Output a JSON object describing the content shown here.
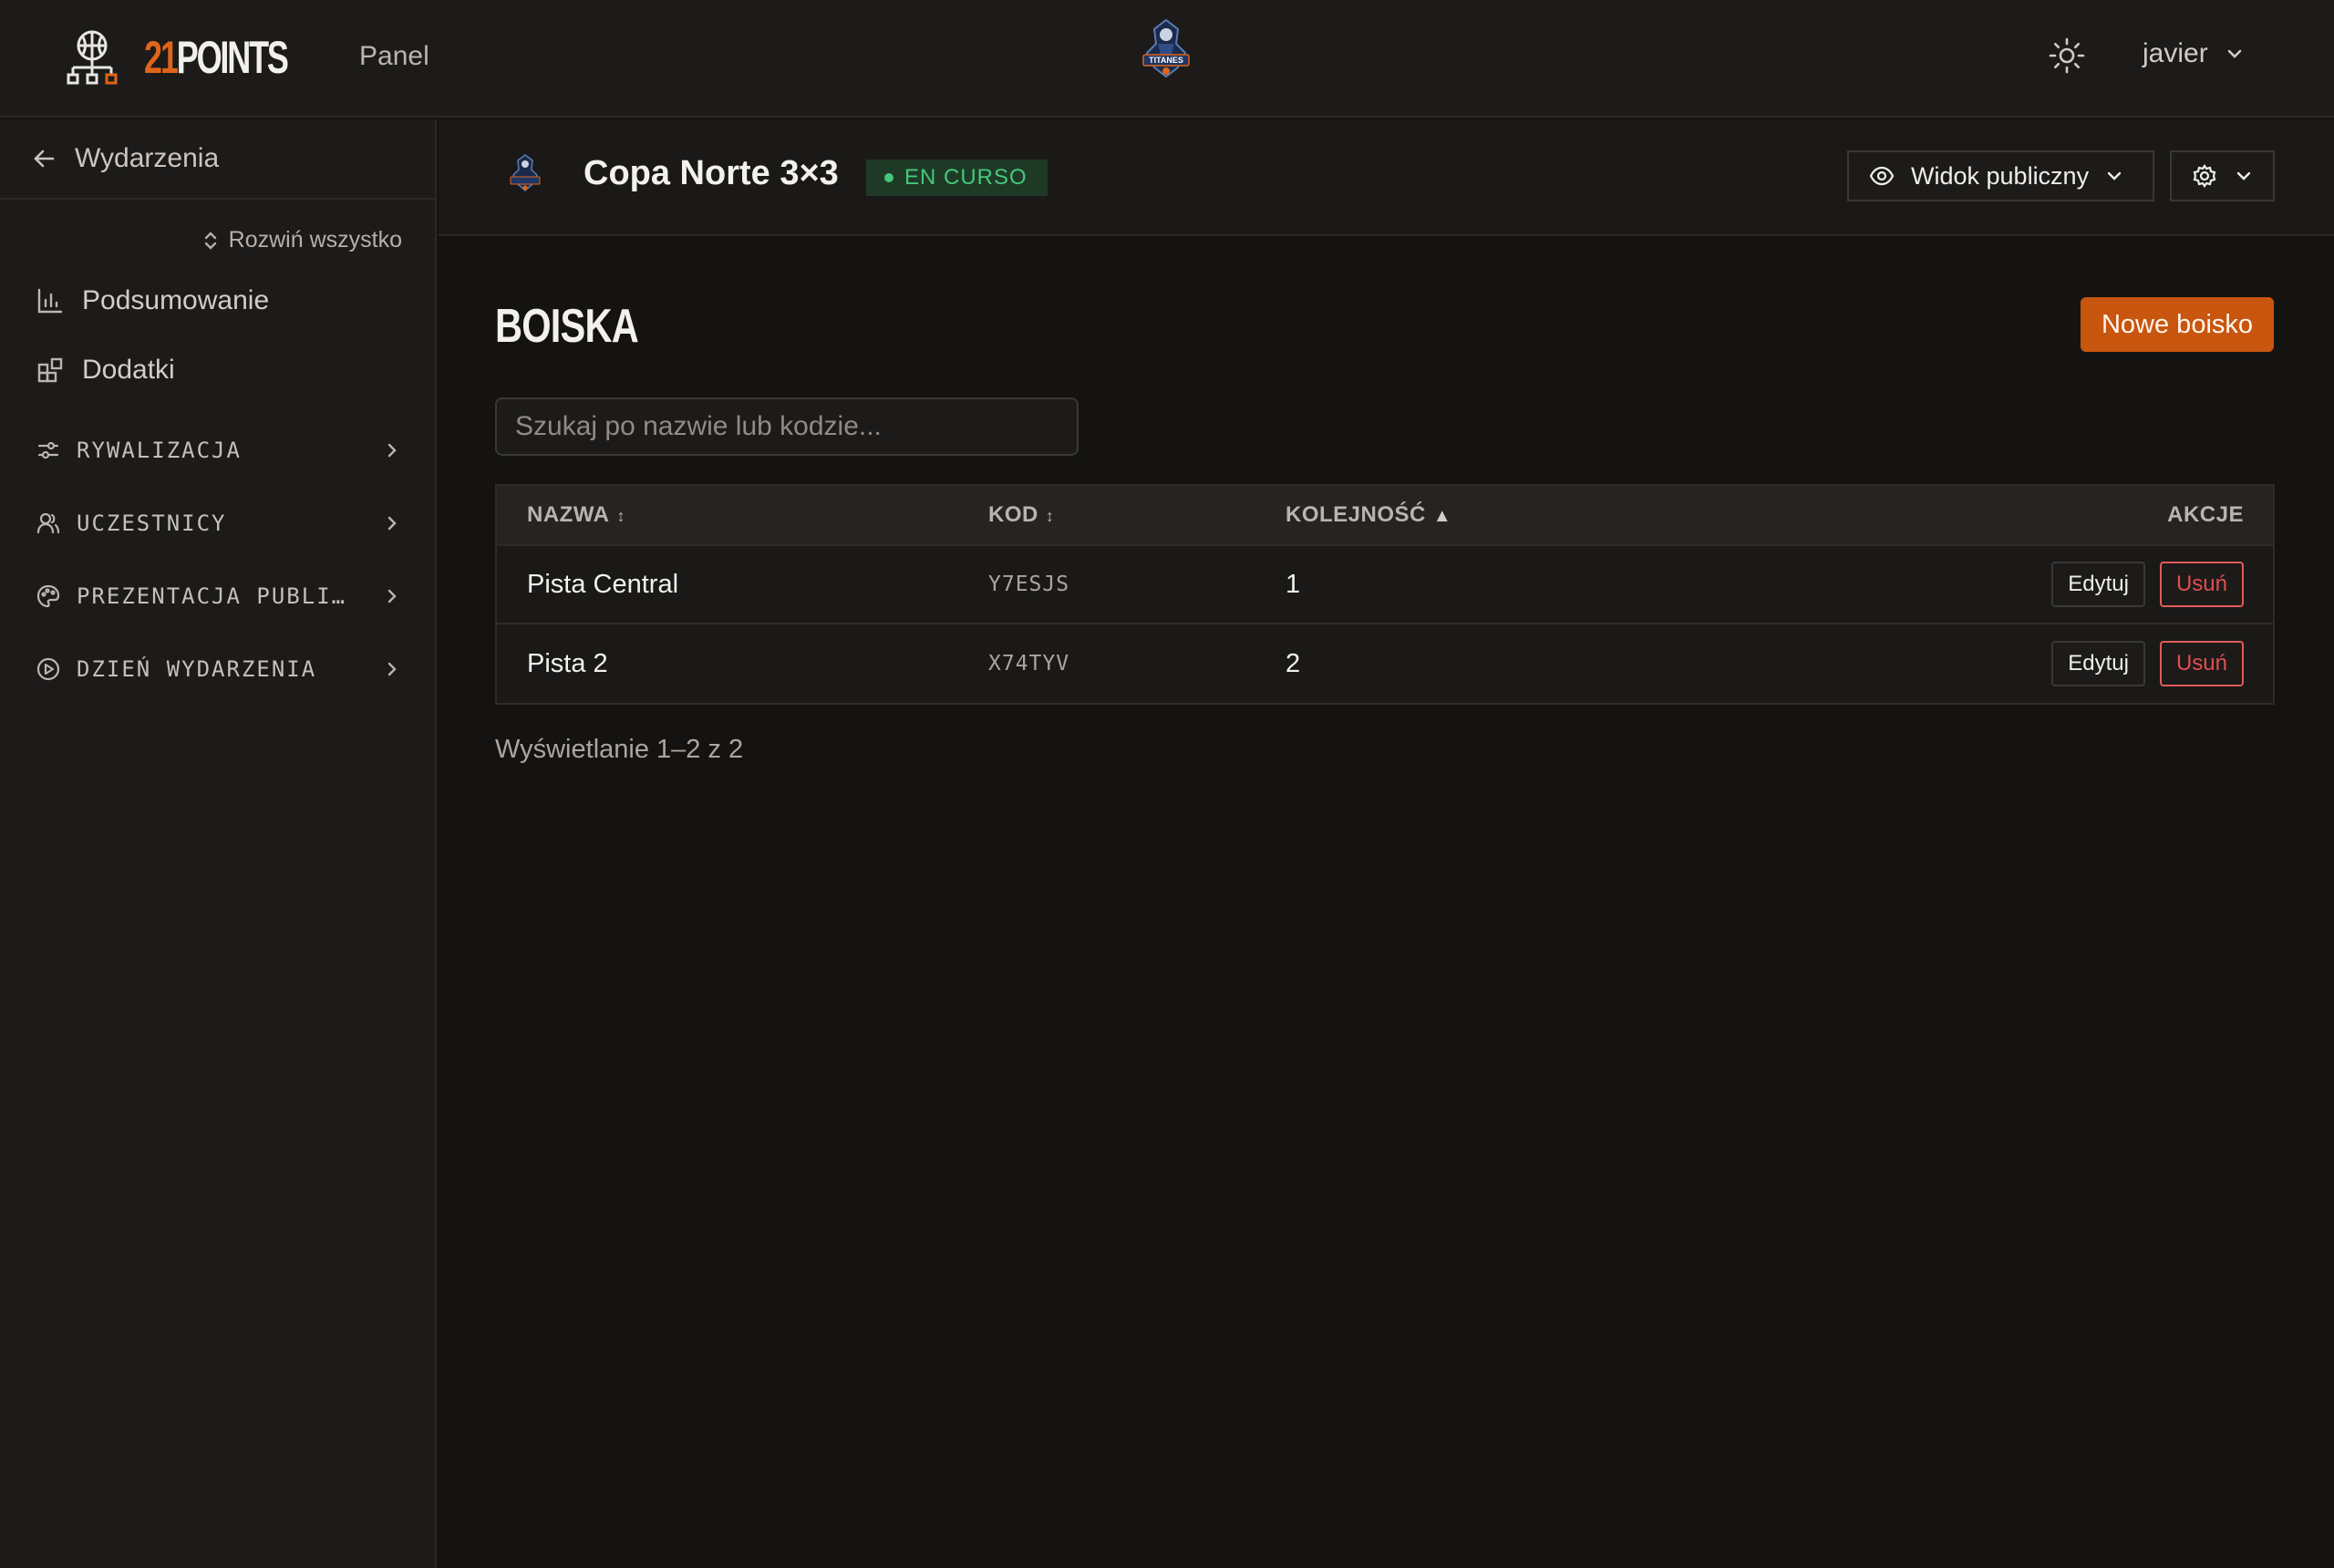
{
  "topbar": {
    "brand_number": "21",
    "brand_word": "POINTS",
    "nav_panel": "Panel",
    "club_logo_text": "TITANES",
    "user_name": "javier"
  },
  "sidebar": {
    "back_label": "Wydarzenia",
    "expand_all": "Rozwiń wszystko",
    "items": [
      {
        "label": "Podsumowanie",
        "icon": "bar-chart-icon"
      },
      {
        "label": "Dodatki",
        "icon": "addons-icon"
      }
    ],
    "groups": [
      {
        "label": "RYWALIZACJA",
        "icon": "sliders-icon"
      },
      {
        "label": "UCZESTNICY",
        "icon": "users-icon"
      },
      {
        "label": "PREZENTACJA PUBLICZNA",
        "icon": "palette-icon"
      },
      {
        "label": "DZIEŃ WYDARZENIA",
        "icon": "play-circle-icon"
      }
    ]
  },
  "event": {
    "title": "Copa Norte 3×3",
    "status": "EN CURSO",
    "public_view": "Widok publiczny"
  },
  "main": {
    "title": "BOISKA",
    "new_button": "Nowe boisko",
    "search_placeholder": "Szukaj po nazwie lub kodzie...",
    "columns": {
      "name": "NAZWA",
      "code": "KOD",
      "order": "KOLEJNOŚĆ",
      "actions": "AKCJE"
    },
    "rows": [
      {
        "name": "Pista Central",
        "code": "Y7ESJS",
        "order": "1",
        "edit": "Edytuj",
        "delete": "Usuń"
      },
      {
        "name": "Pista 2",
        "code": "X74TYV",
        "order": "2",
        "edit": "Edytuj",
        "delete": "Usuń"
      }
    ],
    "paging": "Wyświetlanie 1–2 z 2"
  },
  "colors": {
    "accent": "#c8560f",
    "brand_orange": "#e0641a",
    "status_green": "#45c77a",
    "danger": "#e04e4e"
  }
}
